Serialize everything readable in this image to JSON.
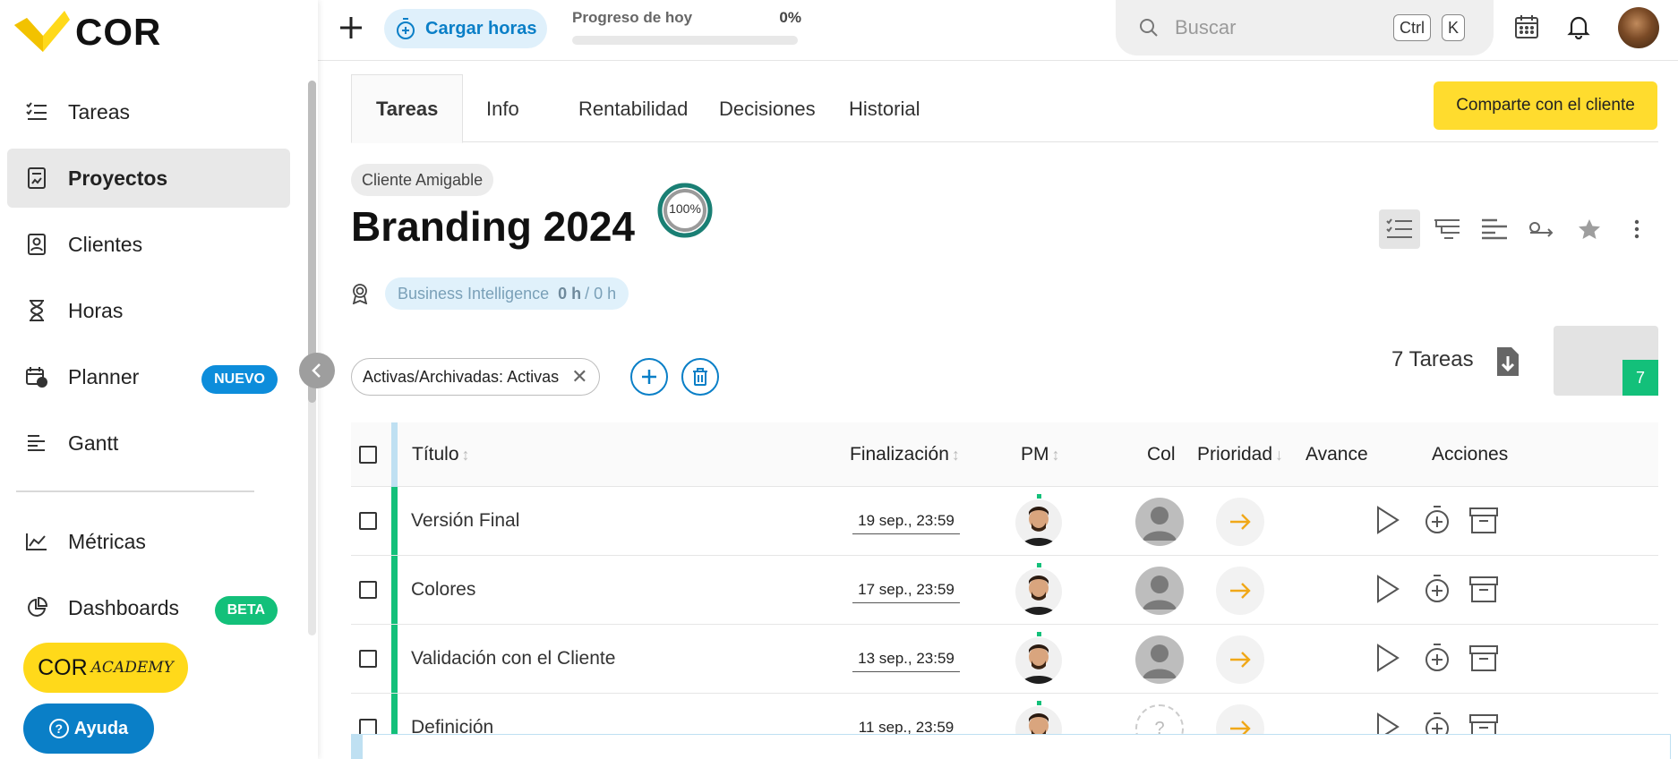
{
  "brand": {
    "name": "COR",
    "accent": "#ffd91a"
  },
  "sidebar": {
    "items": [
      {
        "label": "Tareas",
        "icon": "tasks-icon"
      },
      {
        "label": "Proyectos",
        "icon": "projects-icon",
        "active": true
      },
      {
        "label": "Clientes",
        "icon": "clients-icon"
      },
      {
        "label": "Horas",
        "icon": "hourglass-icon"
      },
      {
        "label": "Planner",
        "icon": "calendar-icon",
        "badge": "NUEVO"
      },
      {
        "label": "Gantt",
        "icon": "gantt-icon"
      }
    ],
    "lower_items": [
      {
        "label": "Métricas",
        "icon": "metrics-icon"
      },
      {
        "label": "Dashboards",
        "icon": "dashboards-icon",
        "badge": "BETA"
      }
    ],
    "academy": {
      "cor": "COR",
      "academy": "ACADEMY"
    },
    "help": "Ayuda"
  },
  "topbar": {
    "cargar_horas": "Cargar horas",
    "progress_label": "Progreso de hoy",
    "progress_value": "0%",
    "progress_fraction": 0,
    "search_placeholder": "Buscar",
    "kbd_ctrl": "Ctrl",
    "kbd_k": "K"
  },
  "tabs": [
    "Tareas",
    "Info",
    "Rentabilidad",
    "Decisiones",
    "Historial"
  ],
  "share_button": "Comparte con el cliente",
  "project": {
    "client": "Cliente Amigable",
    "title": "Branding 2024",
    "progress": "100%",
    "area": "Business Intelligence",
    "hours_used": "0 h",
    "hours_total": "/ 0 h"
  },
  "filter": {
    "label": "Activas/Archivadas: Activas"
  },
  "task_count": {
    "label": "7 Tareas",
    "badge": "7"
  },
  "table": {
    "headers": {
      "title": "Título",
      "end": "Finalización",
      "pm": "PM",
      "col": "Col",
      "priority": "Prioridad",
      "progress": "Avance",
      "actions": "Acciones"
    },
    "rows": [
      {
        "title": "Versión Final",
        "date": "19 sep., 23:59",
        "collab": "avatar"
      },
      {
        "title": "Colores",
        "date": "17 sep., 23:59",
        "collab": "avatar"
      },
      {
        "title": "Validación con el Cliente",
        "date": "13 sep., 23:59",
        "collab": "avatar"
      },
      {
        "title": "Definición",
        "date": "11 sep., 23:59",
        "collab": "unknown",
        "collab_text": "?"
      }
    ]
  }
}
